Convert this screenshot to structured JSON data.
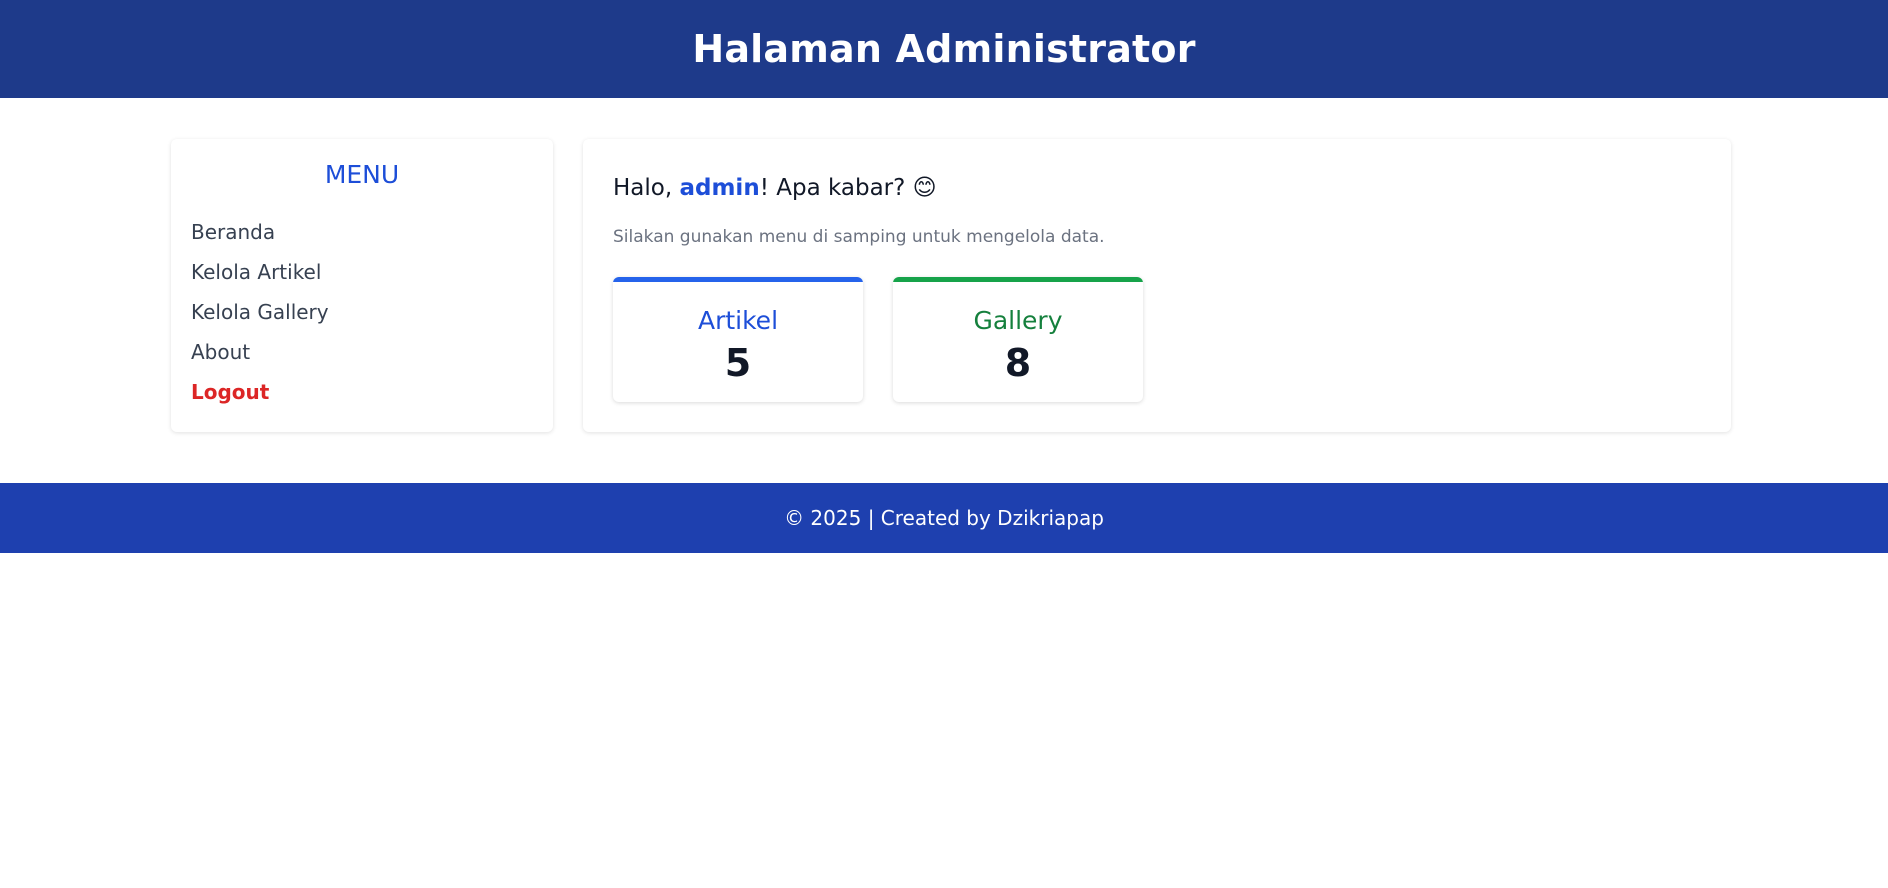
{
  "header": {
    "title": "Halaman Administrator"
  },
  "sidebar": {
    "heading": "MENU",
    "items": [
      {
        "label": "Beranda"
      },
      {
        "label": "Kelola Artikel"
      },
      {
        "label": "Kelola Gallery"
      },
      {
        "label": "About"
      },
      {
        "label": "Logout"
      }
    ]
  },
  "main": {
    "greeting_prefix": "Halo, ",
    "username": "admin",
    "greeting_suffix": "! Apa kabar? 😊",
    "instruction": "Silakan gunakan menu di samping untuk mengelola data.",
    "stats": [
      {
        "label": "Artikel",
        "value": "5",
        "accent_color": "#2563eb"
      },
      {
        "label": "Gallery",
        "value": "8",
        "accent_color": "#16a34a"
      }
    ]
  },
  "footer": {
    "text": "© 2025 | Created by Dzikriapap"
  },
  "colors": {
    "header_bg": "#1e3a8a",
    "footer_bg": "#1e40af",
    "primary": "#1d4ed8",
    "danger": "#dc2626"
  }
}
